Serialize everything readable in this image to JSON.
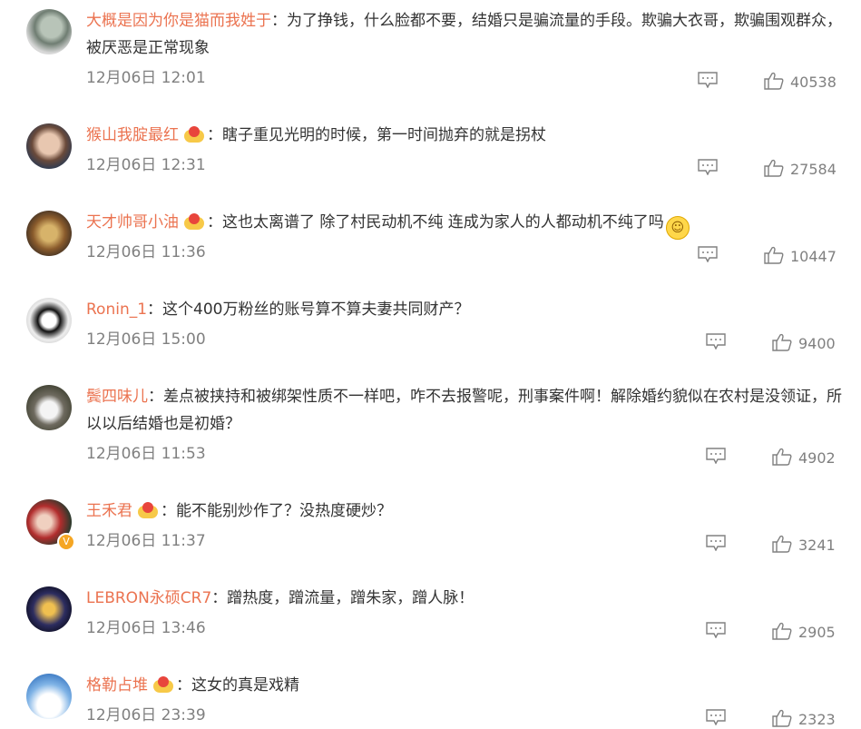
{
  "comments": [
    {
      "username": "大概是因为你是猫而我姓于",
      "badge": false,
      "text": "：为了挣钱，什么脸都不要，结婚只是骗流量的手段。欺骗大衣哥，欺骗围观群众，被厌恶是正常现象",
      "time": "12月06日 12:01",
      "likes": "40538"
    },
    {
      "username": "猴山我腚最红",
      "badge": true,
      "text": "：瞎子重见光明的时候，第一时间抛弃的就是拐杖",
      "time": "12月06日 12:31",
      "likes": "27584"
    },
    {
      "username": "天才帅哥小油",
      "badge": true,
      "text": "：这也太离谱了 除了村民动机不纯 连成为家人的人都动机不纯了吗",
      "time": "12月06日 11:36",
      "likes": "10447"
    },
    {
      "username": "Ronin_1",
      "badge": false,
      "text": "：这个400万粉丝的账号算不算夫妻共同财产？",
      "time": "12月06日 15:00",
      "likes": "9400"
    },
    {
      "username": "鬓四味儿",
      "badge": false,
      "text": "：差点被挟持和被绑架性质不一样吧，咋不去报警呢，刑事案件啊！解除婚约貌似在农村是没领证，所以以后结婚也是初婚？",
      "time": "12月06日 11:53",
      "likes": "4902"
    },
    {
      "username": "王禾君",
      "badge": true,
      "text": "：能不能别炒作了？没热度硬炒？",
      "time": "12月06日 11:37",
      "likes": "3241"
    },
    {
      "username": "LEBRON永硕CR7",
      "badge": false,
      "text": "：蹭热度，蹭流量，蹭朱家，蹭人脉！",
      "time": "12月06日 13:46",
      "likes": "2905"
    },
    {
      "username": "格勒占堆",
      "badge": true,
      "text": "：这女的真是戏精",
      "time": "12月06日 23:39",
      "likes": "2323"
    }
  ],
  "icons": {
    "reply": "comment-icon",
    "like": "thumbs-up-icon",
    "badge": "vip-crown-icon",
    "verified": "verified-v-icon",
    "emoji": "smile-emoji"
  },
  "colors": {
    "username": "#eb7350",
    "text": "#333333",
    "meta": "#808080"
  }
}
